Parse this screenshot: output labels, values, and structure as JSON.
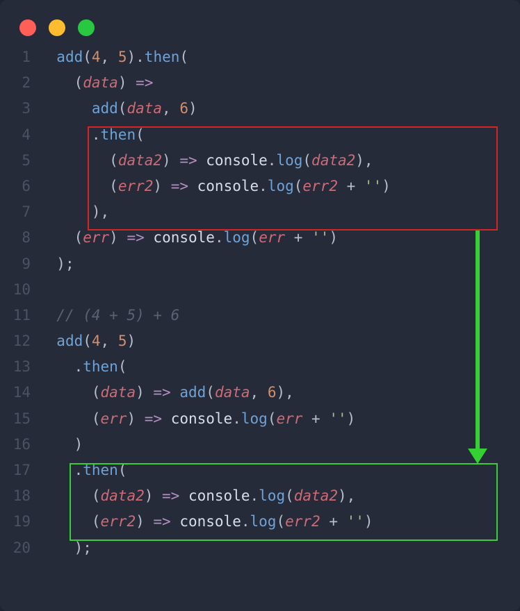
{
  "window": {
    "traffic": {
      "red": "#ff5f57",
      "yellow": "#febc2e",
      "green": "#28c840"
    }
  },
  "gutter": [
    "1",
    "2",
    "3",
    "4",
    "5",
    "6",
    "7",
    "8",
    "9",
    "10",
    "11",
    "12",
    "13",
    "14",
    "15",
    "16",
    "17",
    "18",
    "19",
    "20"
  ],
  "code": {
    "l1": {
      "fn1": "add",
      "p1": "(",
      "n1": "4",
      "c1": ", ",
      "n2": "5",
      "p2": ").",
      "fn2": "then",
      "p3": "("
    },
    "l2": {
      "p1": "(",
      "id": "data",
      "p2": ") ",
      "ar": "=>"
    },
    "l3": {
      "fn": "add",
      "p1": "(",
      "id": "data",
      "c": ", ",
      "n": "6",
      "p2": ")"
    },
    "l4": {
      "p1": ".",
      "fn": "then",
      "p2": "("
    },
    "l5": {
      "p1": "(",
      "id1": "data2",
      "p2": ") ",
      "ar": "=>",
      "sp": " ",
      "obj": "console",
      "dot": ".",
      "fn": "log",
      "p3": "(",
      "id2": "data2",
      "p4": "),"
    },
    "l6": {
      "p1": "(",
      "id1": "err2",
      "p2": ") ",
      "ar": "=>",
      "sp": " ",
      "obj": "console",
      "dot": ".",
      "fn": "log",
      "p3": "(",
      "id2": "err2",
      "op": " + ",
      "str": "''",
      "p4": ")"
    },
    "l7": {
      "p": "),"
    },
    "l8": {
      "p1": "(",
      "id1": "err",
      "p2": ") ",
      "ar": "=>",
      "sp": " ",
      "obj": "console",
      "dot": ".",
      "fn": "log",
      "p3": "(",
      "id2": "err",
      "op": " + ",
      "str": "''",
      "p4": ")"
    },
    "l9": {
      "p": ");"
    },
    "l11": {
      "cmt": "// (4 + 5) + 6"
    },
    "l12": {
      "fn": "add",
      "p1": "(",
      "n1": "4",
      "c": ", ",
      "n2": "5",
      "p2": ")"
    },
    "l13": {
      "p1": ".",
      "fn": "then",
      "p2": "("
    },
    "l14": {
      "p1": "(",
      "id1": "data",
      "p2": ") ",
      "ar": "=>",
      "sp": " ",
      "fn": "add",
      "p3": "(",
      "id2": "data",
      "c": ", ",
      "n": "6",
      "p4": "),"
    },
    "l15": {
      "p1": "(",
      "id1": "err",
      "p2": ") ",
      "ar": "=>",
      "sp": " ",
      "obj": "console",
      "dot": ".",
      "fn": "log",
      "p3": "(",
      "id2": "err",
      "op": " + ",
      "str": "''",
      "p4": ")"
    },
    "l16": {
      "p": ")"
    },
    "l17": {
      "p1": ".",
      "fn": "then",
      "p2": "("
    },
    "l18": {
      "p1": "(",
      "id1": "data2",
      "p2": ") ",
      "ar": "=>",
      "sp": " ",
      "obj": "console",
      "dot": ".",
      "fn": "log",
      "p3": "(",
      "id2": "data2",
      "p4": "),"
    },
    "l19": {
      "p1": "(",
      "id1": "err2",
      "p2": ") ",
      "ar": "=>",
      "sp": " ",
      "obj": "console",
      "dot": ".",
      "fn": "log",
      "p3": "(",
      "id2": "err2",
      "op": " + ",
      "str": "''",
      "p4": ")"
    },
    "l20": {
      "p": ");"
    }
  },
  "highlights": {
    "red": {
      "lines": "4-7"
    },
    "green": {
      "lines": "17-19"
    }
  }
}
